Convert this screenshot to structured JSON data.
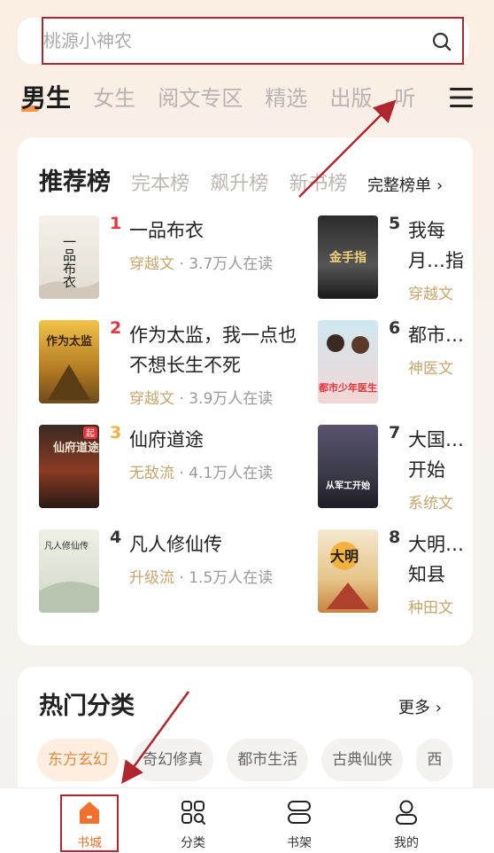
{
  "search": {
    "placeholder": "桃源小神农",
    "icon": "search-icon"
  },
  "tabs": [
    {
      "label": "男生",
      "active": true
    },
    {
      "label": "女生"
    },
    {
      "label": "阅文专区"
    },
    {
      "label": "精选"
    },
    {
      "label": "出版"
    },
    {
      "label": "听"
    }
  ],
  "menu_icon": "menu-icon",
  "ranking": {
    "tabs": [
      "推荐榜",
      "完本榜",
      "飙升榜",
      "新书榜"
    ],
    "full_list_label": "完整榜单",
    "books": [
      {
        "rank": "1",
        "title": "一品布衣",
        "genre": "穿越文",
        "readers": "3.7万人在读"
      },
      {
        "rank": "2",
        "title": "作为太监，我一点也不想长生不死",
        "genre": "穿越文",
        "readers": "3.9万人在读"
      },
      {
        "rank": "3",
        "title": "仙府道途",
        "genre": "无敌流",
        "readers": "4.1万人在读"
      },
      {
        "rank": "4",
        "title": "凡人修仙传",
        "genre": "升级流",
        "readers": "1.5万人在读"
      },
      {
        "rank": "5",
        "title": "我每月…指",
        "genre": "穿越文",
        "readers": ""
      },
      {
        "rank": "6",
        "title": "都市…",
        "genre": "神医文",
        "readers": ""
      },
      {
        "rank": "7",
        "title": "大国…开始",
        "genre": "系统文",
        "readers": ""
      },
      {
        "rank": "8",
        "title": "大明…知县",
        "genre": "种田文",
        "readers": ""
      }
    ],
    "cover_texts": [
      "一品布衣",
      "作为太监",
      "仙府道途",
      "凡人修仙传",
      "金手指",
      "都市少年医生",
      "从军工开始",
      "大明"
    ],
    "badge": "起"
  },
  "categories": {
    "title": "热门分类",
    "more_label": "更多",
    "chips": [
      {
        "label": "东方玄幻",
        "active": true
      },
      {
        "label": "奇幻修真"
      },
      {
        "label": "都市生活"
      },
      {
        "label": "古典仙侠"
      },
      {
        "label": "西"
      }
    ]
  },
  "bottom_nav": [
    {
      "label": "书城",
      "icon": "home-icon",
      "active": true
    },
    {
      "label": "分类",
      "icon": "grid-search-icon"
    },
    {
      "label": "书架",
      "icon": "bookshelf-icon"
    },
    {
      "label": "我的",
      "icon": "profile-icon"
    }
  ],
  "colors": {
    "accent": "#f2702e",
    "highlight_box": "#b0262e",
    "genre": "#c8a56c",
    "rank_red": "#e8353b",
    "rank_gold": "#f2b23e"
  }
}
